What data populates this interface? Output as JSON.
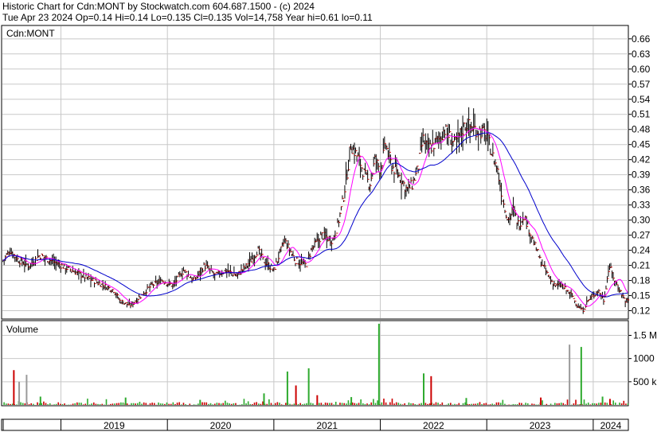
{
  "header": {
    "line1": "Historic Chart for Cdn:MONT by Stockwatch.com 604.687.1500 - (c) 2024",
    "line2": "Tue Apr 23 2024   Op=0.14   Hi=0.14   Lo=0.135   Cl=0.135   Vol=14,758   Year hi=0.61   lo=0.11"
  },
  "chart_data": [
    {
      "type": "ohlc-line",
      "title": "Cdn:MONT",
      "ylim": [
        0.105,
        0.685
      ],
      "y_ticks": [
        "0.66",
        "0.63",
        "0.60",
        "0.57",
        "0.54",
        "0.51",
        "0.48",
        "0.45",
        "0.42",
        "0.39",
        "0.36",
        "0.33",
        "0.30",
        "0.27",
        "0.24",
        "0.21",
        "0.18",
        "0.15",
        "0.12"
      ],
      "x_labels": [
        "2019",
        "2020",
        "2021",
        "2022",
        "2023",
        "2024"
      ],
      "x_label_positions_years": [
        2019.0,
        2020.0,
        2021.0,
        2022.0,
        2023.0,
        2024.0
      ],
      "x_range_years": [
        2018.45,
        2024.33
      ],
      "grid": true,
      "price_points": [
        [
          2018.46,
          0.22
        ],
        [
          2018.52,
          0.24
        ],
        [
          2018.6,
          0.22
        ],
        [
          2018.7,
          0.21
        ],
        [
          2018.8,
          0.23
        ],
        [
          2018.9,
          0.22
        ],
        [
          2019.0,
          0.21
        ],
        [
          2019.1,
          0.2
        ],
        [
          2019.2,
          0.19
        ],
        [
          2019.3,
          0.18
        ],
        [
          2019.4,
          0.17
        ],
        [
          2019.5,
          0.16
        ],
        [
          2019.55,
          0.14
        ],
        [
          2019.65,
          0.13
        ],
        [
          2019.75,
          0.15
        ],
        [
          2019.85,
          0.17
        ],
        [
          2019.95,
          0.18
        ],
        [
          2020.05,
          0.17
        ],
        [
          2020.15,
          0.2
        ],
        [
          2020.25,
          0.18
        ],
        [
          2020.35,
          0.21
        ],
        [
          2020.45,
          0.19
        ],
        [
          2020.55,
          0.2
        ],
        [
          2020.65,
          0.19
        ],
        [
          2020.75,
          0.21
        ],
        [
          2020.85,
          0.24
        ],
        [
          2020.9,
          0.22
        ],
        [
          2021.0,
          0.2
        ],
        [
          2021.05,
          0.23
        ],
        [
          2021.1,
          0.26
        ],
        [
          2021.15,
          0.24
        ],
        [
          2021.2,
          0.22
        ],
        [
          2021.3,
          0.21
        ],
        [
          2021.35,
          0.24
        ],
        [
          2021.45,
          0.27
        ],
        [
          2021.55,
          0.26
        ],
        [
          2021.6,
          0.29
        ],
        [
          2021.65,
          0.34
        ],
        [
          2021.7,
          0.41
        ],
        [
          2021.72,
          0.45
        ],
        [
          2021.8,
          0.42
        ],
        [
          2021.85,
          0.39
        ],
        [
          2021.9,
          0.37
        ],
        [
          2021.95,
          0.42
        ],
        [
          2022.0,
          0.4
        ],
        [
          2022.05,
          0.45
        ],
        [
          2022.1,
          0.41
        ],
        [
          2022.2,
          0.38
        ],
        [
          2022.25,
          0.36
        ],
        [
          2022.3,
          0.37
        ],
        [
          2022.35,
          0.4
        ],
        [
          2022.4,
          0.46
        ],
        [
          2022.45,
          0.44
        ],
        [
          2022.55,
          0.46
        ],
        [
          2022.6,
          0.48
        ],
        [
          2022.7,
          0.45
        ],
        [
          2022.75,
          0.47
        ],
        [
          2022.8,
          0.49
        ],
        [
          2022.9,
          0.48
        ],
        [
          2023.0,
          0.47
        ],
        [
          2023.05,
          0.43
        ],
        [
          2023.1,
          0.4
        ],
        [
          2023.15,
          0.34
        ],
        [
          2023.2,
          0.3
        ],
        [
          2023.25,
          0.32
        ],
        [
          2023.3,
          0.29
        ],
        [
          2023.35,
          0.31
        ],
        [
          2023.4,
          0.28
        ],
        [
          2023.45,
          0.25
        ],
        [
          2023.5,
          0.22
        ],
        [
          2023.55,
          0.2
        ],
        [
          2023.6,
          0.18
        ],
        [
          2023.65,
          0.17
        ],
        [
          2023.7,
          0.17
        ],
        [
          2023.75,
          0.16
        ],
        [
          2023.8,
          0.15
        ],
        [
          2023.85,
          0.13
        ],
        [
          2023.9,
          0.12
        ],
        [
          2023.95,
          0.14
        ],
        [
          2024.0,
          0.15
        ],
        [
          2024.05,
          0.16
        ],
        [
          2024.1,
          0.14
        ],
        [
          2024.15,
          0.21
        ],
        [
          2024.2,
          0.18
        ],
        [
          2024.25,
          0.16
        ],
        [
          2024.3,
          0.14
        ]
      ],
      "series": [
        {
          "name": "",
          "color": "#ff00ff",
          "kind": "short-ma"
        },
        {
          "name": "",
          "color": "#0000cc",
          "kind": "long-ma"
        }
      ],
      "colors": {
        "bar": "#000000",
        "close_tick": "#cc0000",
        "grid": "#c8c8c8"
      }
    },
    {
      "type": "bar",
      "title": "Volume",
      "ylim": [
        0,
        1800000
      ],
      "y_ticks": [
        {
          "label": "1.5 M",
          "value": 1500000
        },
        {
          "label": "1000",
          "value": 1000000
        },
        {
          "label": "500 k",
          "value": 500000
        }
      ],
      "spikes": [
        [
          2018.55,
          750000,
          "#cc0000"
        ],
        [
          2018.6,
          500000,
          "#9a9a9a"
        ],
        [
          2018.67,
          650000,
          "#9a9a9a"
        ],
        [
          2018.8,
          180000,
          "#2eaa2e"
        ],
        [
          2019.6,
          160000,
          "#2eaa2e"
        ],
        [
          2020.3,
          110000,
          "#2eaa2e"
        ],
        [
          2020.9,
          250000,
          "#2eaa2e"
        ],
        [
          2021.12,
          720000,
          "#2eaa2e"
        ],
        [
          2021.2,
          420000,
          "#cc0000"
        ],
        [
          2021.32,
          790000,
          "#2eaa2e"
        ],
        [
          2021.4,
          210000,
          "#cc0000"
        ],
        [
          2021.72,
          170000,
          "#2eaa2e"
        ],
        [
          2021.98,
          1750000,
          "#2eaa2e"
        ],
        [
          2022.4,
          680000,
          "#2eaa2e"
        ],
        [
          2022.47,
          620000,
          "#cc0000"
        ],
        [
          2022.8,
          150000,
          "#2eaa2e"
        ],
        [
          2023.5,
          160000,
          "#cc0000"
        ],
        [
          2023.77,
          1300000,
          "#9a9a9a"
        ],
        [
          2023.88,
          1250000,
          "#2eaa2e"
        ],
        [
          2024.08,
          180000,
          "#2eaa2e"
        ],
        [
          2024.15,
          130000,
          "#cc0000"
        ]
      ]
    }
  ]
}
